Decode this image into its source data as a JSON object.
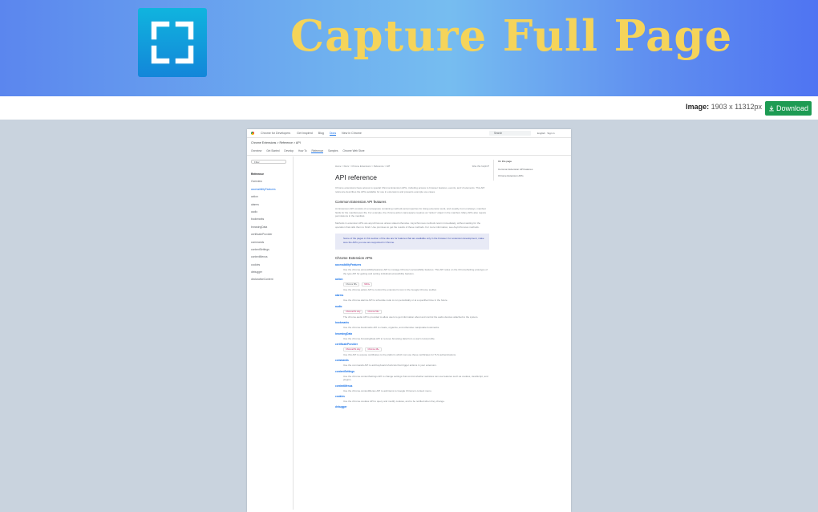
{
  "banner": {
    "title": "Capture Full Page",
    "icon": "fullscreen-corners-icon",
    "colors": {
      "title": "#f5d45a",
      "gradient_start": "#5b86ee",
      "gradient_end": "#4f74f2",
      "icon_top": "#10b4de",
      "icon_bottom": "#1386d9"
    }
  },
  "toolbar": {
    "image_label": "Image:",
    "image_dims": "1903 x 11312px",
    "download_label": "Download",
    "download_color": "#1d9b53"
  },
  "preview": {
    "site_name": "Chrome for Developers",
    "nav": [
      "Get Inspired",
      "Blog",
      "Docs",
      "New in Chrome"
    ],
    "search_placeholder": "Search",
    "language": "English",
    "sign_in": "Sign in",
    "breadcrumb": "Chrome Extensions  >  Reference  >  API",
    "tabs": [
      "Overview",
      "Get Started",
      "Develop",
      "How To",
      "Reference",
      "Samples",
      "Chrome Web Store"
    ],
    "sidebar_filter": "Filter",
    "sidebar_items": [
      "Reference",
      "Overview",
      "accessibilityFeatures",
      "action",
      "alarms",
      "audio",
      "bookmarks",
      "browsingData",
      "certificateProvider",
      "commands",
      "contentSettings",
      "contextMenus",
      "cookies",
      "debugger",
      "declarativeContent"
    ],
    "main_breadcrumb": "Home  >  Docs  >  Chrome Extensions  >  Reference  >  API",
    "main_actions": "Was this helpful?",
    "page_title": "API reference",
    "intro": "Chrome extensions have access to special Chrome Extension APIs, including access to browser features, events, and UI elements. This API reference describes the APIs available for use in extensions and presents example use cases.",
    "section1_title": "Common Extension API features",
    "section1_para1": "An Extension API consists of a namespace containing methods and properties for doing extension work, and usually, but not always, manifest fields for the manifest.json file. For example, the chrome.action namespace requires an \"action\" object in the manifest. Many APIs also require permissions in the manifest.",
    "section1_para2": "Methods in extension APIs are asynchronous unless stated otherwise. Asynchronous methods return immediately, without waiting for the operation that calls them to finish. Use promises to get the results of these methods. For more information, see Asynchronous methods.",
    "note": "Some of the pages in this section of the site are for features that are available only in the browser. For extension development, make sure the APIs you use are supported in Chrome.",
    "section2_title": "Chrome Extension APIs",
    "apis": [
      {
        "name": "accessibilityFeatures",
        "chips": [],
        "desc": "Use the chrome.accessibilityFeatures API to manage Chrome's accessibility features. This API relies on the ChromeSetting prototype of the type API for getting and setting individual accessibility features."
      },
      {
        "name": "action",
        "chips": [
          "Chrome 88+",
          "MV3+"
        ],
        "desc": "Use the chrome.action API to control the extension's icon in the Google Chrome toolbar."
      },
      {
        "name": "alarms",
        "chips": [],
        "desc": "Use the chrome.alarms API to schedule code to run periodically or at a specified time in the future."
      },
      {
        "name": "audio",
        "chips": [
          "ChromeOS only",
          "Chrome 59+"
        ],
        "desc": "The chrome.audio API is provided to allow users to get information about and control the audio devices attached to the system."
      },
      {
        "name": "bookmarks",
        "chips": [],
        "desc": "Use the chrome.bookmarks API to create, organize, and otherwise manipulate bookmarks."
      },
      {
        "name": "browsingData",
        "chips": [],
        "desc": "Use the chrome.browsingData API to remove browsing data from a user's local profile."
      },
      {
        "name": "certificateProvider",
        "chips": [
          "ChromeOS only",
          "Chrome 46+"
        ],
        "desc": "Use this API to expose certificates to the platform which can use these certificates for TLS authentications."
      },
      {
        "name": "commands",
        "chips": [],
        "desc": "Use the commands API to add keyboard shortcuts that trigger actions in your extension."
      },
      {
        "name": "contentSettings",
        "chips": [],
        "desc": "Use the chrome.contentSettings API to change settings that control whether websites can use features such as cookies, JavaScript, and plugins."
      },
      {
        "name": "contextMenus",
        "chips": [],
        "desc": "Use the chrome.contextMenus API to add items to Google Chrome's context menu."
      },
      {
        "name": "cookies",
        "chips": [],
        "desc": "Use the chrome.cookies API to query and modify cookies, and to be notified when they change."
      },
      {
        "name": "debugger",
        "chips": [],
        "desc": ""
      }
    ],
    "toc": [
      "On this page",
      "Common Extension API features",
      "Chrome Extension APIs"
    ]
  }
}
